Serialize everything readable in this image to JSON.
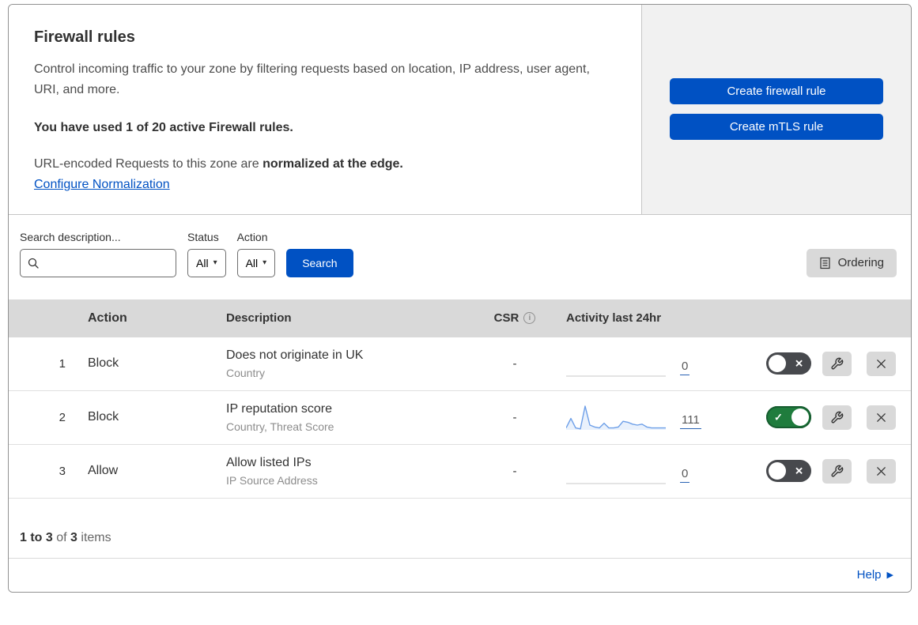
{
  "header": {
    "title": "Firewall rules",
    "description": "Control incoming traffic to your zone by filtering requests based on location, IP address, user agent, URI, and more.",
    "usage_line": "You have used 1 of 20 active Firewall rules.",
    "normalization_prefix": "URL-encoded Requests to this zone are ",
    "normalization_bold": "normalized at the edge.",
    "normalization_link": "Configure Normalization",
    "buttons": [
      {
        "label": "Create firewall rule"
      },
      {
        "label": "Create mTLS rule"
      }
    ]
  },
  "filters": {
    "search_label": "Search description...",
    "search_value": "",
    "status_label": "Status",
    "status_value": "All",
    "action_label": "Action",
    "action_value": "All",
    "search_button": "Search",
    "ordering_button": "Ordering"
  },
  "table": {
    "columns": {
      "action": "Action",
      "description": "Description",
      "csr": "CSR",
      "activity": "Activity last 24hr"
    },
    "rows": [
      {
        "priority": "1",
        "action": "Block",
        "description": "Does not originate in UK",
        "fields": "Country",
        "csr": "-",
        "activity_count": "0",
        "enabled": false,
        "sparkline": []
      },
      {
        "priority": "2",
        "action": "Block",
        "description": "IP reputation score",
        "fields": "Country, Threat Score",
        "csr": "-",
        "activity_count": "111",
        "enabled": true,
        "sparkline": [
          2,
          12,
          2,
          1,
          25,
          5,
          3,
          2,
          7,
          2,
          2,
          3,
          9,
          8,
          6,
          5,
          6,
          3,
          2,
          2,
          2,
          2
        ]
      },
      {
        "priority": "3",
        "action": "Allow",
        "description": "Allow listed IPs",
        "fields": "IP Source Address",
        "csr": "-",
        "activity_count": "0",
        "enabled": false,
        "sparkline": []
      }
    ]
  },
  "footer": {
    "pagination_range": "1 to 3",
    "pagination_of": " of ",
    "pagination_total": "3",
    "pagination_items": " items",
    "help_label": "Help"
  },
  "icons": {
    "dropdown_caret": "▾",
    "info": "i",
    "toggle_on_check": "✓",
    "toggle_off_x": "✕",
    "help_arrow": "▶"
  },
  "colors": {
    "accent_blue": "#0051c3",
    "toggle_on_green": "#1f7c3d",
    "toggle_off_gray": "#47494d",
    "panel_gray": "#f1f1f1",
    "table_header_gray": "#d9d9d9",
    "sparkline_blue": "#6d9fe8"
  }
}
